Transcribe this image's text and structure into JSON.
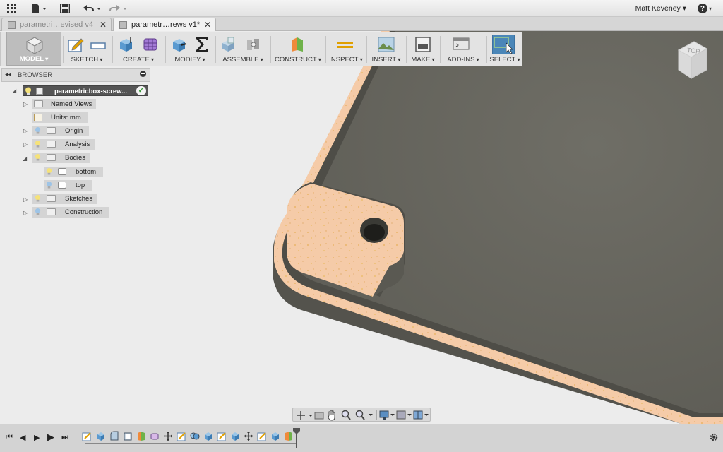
{
  "app": {
    "user_name": "Matt Keveney",
    "help_label": "?"
  },
  "tabs": [
    {
      "label": "parametri…evised v4",
      "active": false
    },
    {
      "label": "parametr…rews v1*",
      "active": true
    }
  ],
  "toolbar": {
    "workspace_label": "MODEL",
    "groups": [
      "SKETCH",
      "CREATE",
      "MODIFY",
      "ASSEMBLE",
      "CONSTRUCT",
      "INSPECT",
      "INSERT",
      "MAKE",
      "ADD-INS",
      "SELECT"
    ]
  },
  "browser": {
    "title": "BROWSER",
    "root": "parametricbox-screw...",
    "items": [
      {
        "label": "Named Views"
      },
      {
        "label": "Units: mm"
      },
      {
        "label": "Origin"
      },
      {
        "label": "Analysis"
      },
      {
        "label": "Bodies"
      },
      {
        "label": "bottom"
      },
      {
        "label": "top"
      },
      {
        "label": "Sketches"
      },
      {
        "label": "Construction"
      }
    ]
  },
  "viewcube": {
    "face_label": "TOP"
  },
  "colors": {
    "accent_blue": "#4a86b8",
    "model_face": "#6b6b62",
    "section_color": "#f3c9a6",
    "toolbar_bg": "#e3e3e3"
  }
}
